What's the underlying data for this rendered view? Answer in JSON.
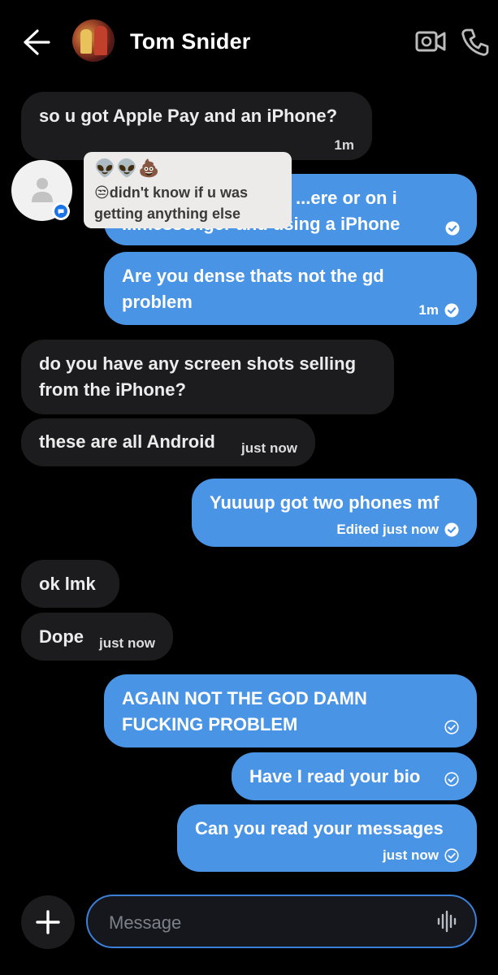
{
  "header": {
    "contact_name": "Tom Snider"
  },
  "messages": [
    {
      "text": "so u got Apple Pay and an iPhone?",
      "meta": "1m"
    },
    {
      "text": "...ere or on i",
      "line2": "...messenger and using a iPhone"
    },
    {
      "text": "Are you dense thats not the gd problem",
      "meta": "1m"
    },
    {
      "text": "do you have any screen shots selling from the iPhone?"
    },
    {
      "text": "these are all Android",
      "meta": "just now"
    },
    {
      "text": "Yuuuup got two phones mf",
      "meta": "Edited just now"
    },
    {
      "text": "ok lmk"
    },
    {
      "text": "Dope",
      "meta": "just now"
    },
    {
      "text": "AGAIN NOT THE GOD DAMN FUCKING PROBLEM"
    },
    {
      "text": "Have I read your bio"
    },
    {
      "text": "Can you read your messages",
      "meta": "just now"
    }
  ],
  "notification": {
    "emoji_row": "👽👽💩",
    "line1": "😒didn't know if u was",
    "line2": "getting anything else"
  },
  "composer": {
    "placeholder": "Message"
  },
  "colors": {
    "incoming": "#1c1c1e",
    "outgoing": "#4a94e6",
    "accent": "#3c7fd6"
  }
}
